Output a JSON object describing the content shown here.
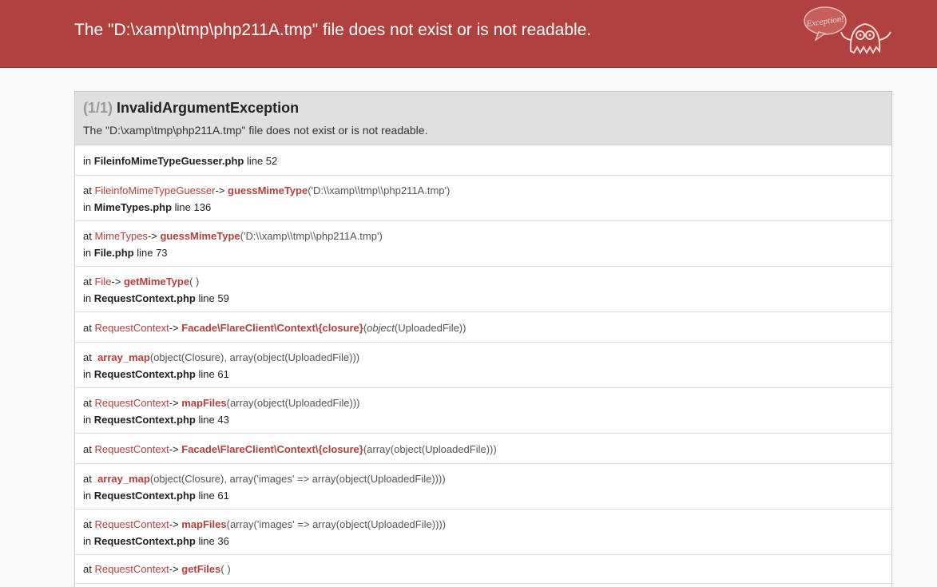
{
  "header": {
    "title": "The \"D:\\xamp\\tmp\\php211A.tmp\" file does not exist or is not readable.",
    "logo_text": "Exception!"
  },
  "exception": {
    "count": "(1/1)",
    "class": "InvalidArgumentException",
    "message": "The \"D:\\xamp\\tmp\\php211A.tmp\" file does not exist or is not readable."
  },
  "trace": [
    {
      "in_label": "in",
      "file": "FileinfoMimeTypeGuesser.php",
      "line_text": "line 52"
    },
    {
      "at_label": "at",
      "class": "FileinfoMimeTypeGuesser",
      "arrow": "->",
      "function": "guessMimeType",
      "args": "('D:\\\\xamp\\\\tmp\\\\php211A.tmp')",
      "in_label": "in",
      "file": "MimeTypes.php",
      "line_text": "line 136"
    },
    {
      "at_label": "at",
      "class": "MimeTypes",
      "arrow": "->",
      "function": "guessMimeType",
      "args": "('D:\\\\xamp\\\\tmp\\\\php211A.tmp')",
      "in_label": "in",
      "file": "File.php",
      "line_text": "line 73"
    },
    {
      "at_label": "at",
      "class": "File",
      "arrow": "->",
      "function": "getMimeType",
      "args": "( )",
      "in_label": "in",
      "file": "RequestContext.php",
      "line_text": "line 59"
    },
    {
      "at_label": "at",
      "class": "RequestContext",
      "arrow": "->",
      "function": "Facade\\FlareClient\\Context\\{closure}",
      "args_open": "(",
      "args_obj": "object",
      "args_rest": "(UploadedFile))"
    },
    {
      "at_label": "at",
      "function": "array_map",
      "args_text": "(object(Closure), array(object(UploadedFile)))",
      "in_label": "in",
      "file": "RequestContext.php",
      "line_text": "line 61"
    },
    {
      "at_label": "at",
      "class": "RequestContext",
      "arrow": "->",
      "function": "mapFiles",
      "args_text": "(array(object(UploadedFile)))",
      "in_label": "in",
      "file": "RequestContext.php",
      "line_text": "line 43"
    },
    {
      "at_label": "at",
      "class": "RequestContext",
      "arrow": "->",
      "function": "Facade\\FlareClient\\Context\\{closure}",
      "args_text": "(array(object(UploadedFile)))"
    },
    {
      "at_label": "at",
      "function": "array_map",
      "args_text": "(object(Closure), array('images' => array(object(UploadedFile))))",
      "in_label": "in",
      "file": "RequestContext.php",
      "line_text": "line 61"
    },
    {
      "at_label": "at",
      "class": "RequestContext",
      "arrow": "->",
      "function": "mapFiles",
      "args_text": "(array('images' => array(object(UploadedFile))))",
      "in_label": "in",
      "file": "RequestContext.php",
      "line_text": "line 36"
    },
    {
      "at_label": "at",
      "class": "RequestContext",
      "arrow": "->",
      "function": "getFiles",
      "args": "( )"
    }
  ]
}
